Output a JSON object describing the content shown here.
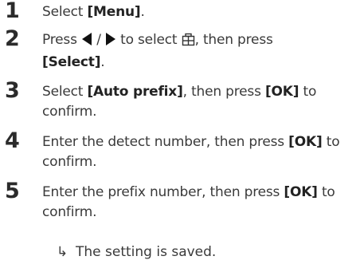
{
  "steps": [
    {
      "number": "1",
      "prefix": "Select ",
      "bold_1": "[Menu]",
      "suffix": "."
    },
    {
      "number": "2",
      "prefix": "Press",
      "separator": "/",
      "middle": "to select",
      "middle_2": ", then press",
      "bold_1": "[Select]",
      "suffix": "."
    },
    {
      "number": "3",
      "prefix": "Select ",
      "bold_1": "[Auto prefix]",
      "middle": ", then press ",
      "bold_2": "[OK]",
      "suffix": " to confirm."
    },
    {
      "number": "4",
      "prefix": "Enter the detect number, then press ",
      "bold_1": "[OK]",
      "suffix": " to confirm."
    },
    {
      "number": "5",
      "prefix": "Enter the prefix number, then press ",
      "bold_1": "[OK]",
      "suffix": " to confirm."
    }
  ],
  "result": {
    "arrow": "↳",
    "text": "The setting is saved."
  },
  "icons": {
    "left": "left-triangle-icon",
    "right": "right-triangle-icon",
    "menu": "phonebook-icon"
  },
  "colors": {
    "text": "#3a3a3a",
    "bold": "#222222"
  }
}
